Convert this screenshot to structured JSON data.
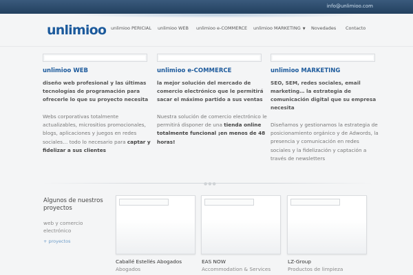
{
  "header": {
    "email": "info@unlimioo.com",
    "logo": "unlimioo"
  },
  "nav": {
    "items": [
      {
        "label": "unlimioo PERICIAL"
      },
      {
        "label": "unlimioo WEB"
      },
      {
        "label": "unlimioo e-COMMERCE"
      },
      {
        "label": "unlimioo MARKETING",
        "has_dropdown": true
      },
      {
        "label": "Novedades"
      },
      {
        "label": "Contacto"
      }
    ],
    "dropdown_icon": "chevron-down-icon"
  },
  "services": [
    {
      "title": "unlimioo WEB",
      "lead": "diseño web profesional y las últimas tecnologías de programación para ofrecerle lo que su proyecto necesita",
      "body_parts": [
        "Webs corporativas totalmente actualizables, micrositios promocionales, blogs, aplicaciones y juegos en redes sociales… todo lo necesario para ",
        "captar y fidelizar a sus clientes",
        ""
      ]
    },
    {
      "title": "unlimioo e-COMMERCE",
      "lead": "la mejor solución del mercado de comercio electrónico que le permitirá sacar el máximo partido a sus ventas",
      "body_parts": [
        "Nuestra solución de comercio electrónico le permitirá disponer de una ",
        "tienda online totalmente funcional ¡en menos de 48 horas!",
        ""
      ]
    },
    {
      "title": "unlimioo MARKETING",
      "lead": "SEO, SEM, redes sociales, email marketing… la estrategia de comunicación digital que su empresa necesita",
      "body_parts": [
        "Diseñamos y gestionamos la estrategia de posicionamiento orgánico y de Adwords, la presencia y comunicación en redes sociales y la fidelización y captación a través de newsletters",
        "",
        ""
      ]
    }
  ],
  "projects": {
    "heading": "Algunos de nuestros proyectos",
    "subheading": "web y comercio electrónico",
    "more_link": "+ proyectos",
    "items": [
      {
        "title": "Caballé Estellés Abogados",
        "subtitle": "Abogados"
      },
      {
        "title": "EAS NOW",
        "subtitle": "Accommodation & Services"
      },
      {
        "title": "LZ-Group",
        "subtitle": "Productos de limpieza"
      }
    ]
  }
}
